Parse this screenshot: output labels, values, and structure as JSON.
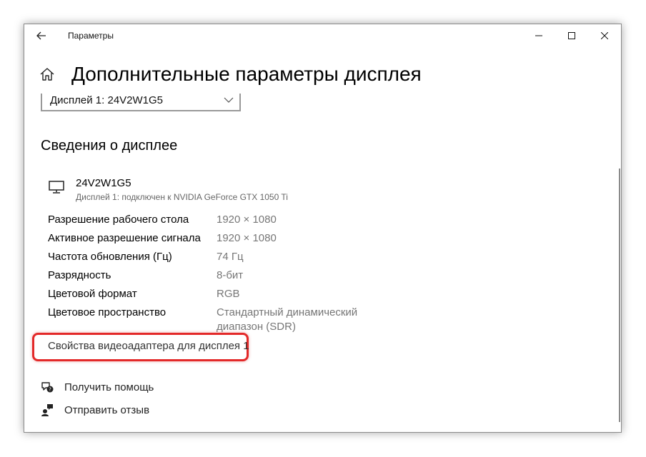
{
  "window": {
    "title": "Параметры"
  },
  "page": {
    "title": "Дополнительные параметры дисплея"
  },
  "display_select": {
    "selected": "Дисплей 1: 24V2W1G5"
  },
  "section": {
    "title": "Сведения о дисплее"
  },
  "monitor": {
    "name": "24V2W1G5",
    "subtitle": "Дисплей 1: подключен к NVIDIA GeForce GTX 1050 Ti"
  },
  "info_rows": [
    {
      "label": "Разрешение рабочего стола",
      "value": "1920 × 1080"
    },
    {
      "label": "Активное разрешение сигнала",
      "value": "1920 × 1080"
    },
    {
      "label": "Частота обновления (Гц)",
      "value": "74 Гц"
    },
    {
      "label": "Разрядность",
      "value": "8-бит"
    },
    {
      "label": "Цветовой формат",
      "value": "RGB"
    },
    {
      "label": "Цветовое пространство",
      "value_line1": "Стандартный динамический",
      "value_line2": "диапазон (SDR)"
    }
  ],
  "adapter_link": "Свойства видеоадаптера для дисплея 1",
  "help": {
    "get_help": "Получить помощь",
    "feedback": "Отправить отзыв"
  },
  "colors": {
    "highlight": "#e32929",
    "value_gray": "#767676"
  }
}
